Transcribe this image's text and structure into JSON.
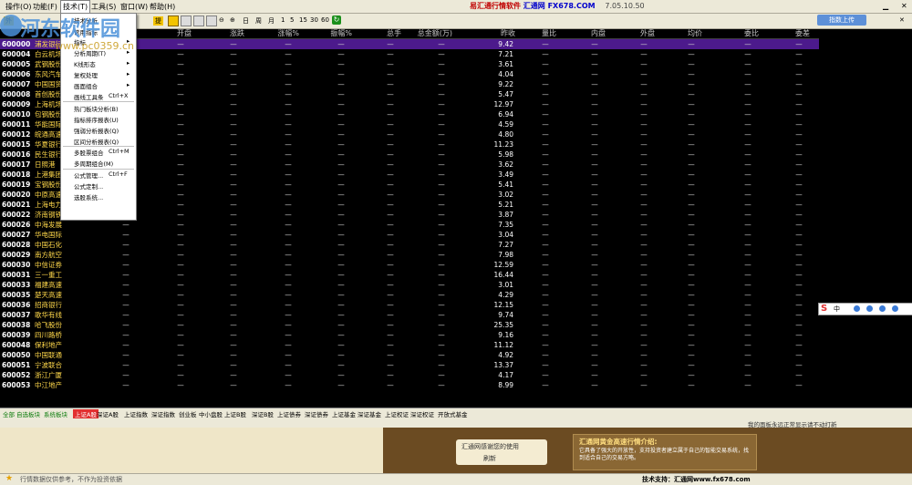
{
  "menu": {
    "items": [
      "操作(O)",
      "功能(F)",
      "技术(T)",
      "工具(S)",
      "窗口(W)",
      "帮助(H)"
    ],
    "active_index": 2,
    "app_title": "易汇通行情软件",
    "app_site": "汇通网 FX678.COM",
    "version": "7.05.10.50"
  },
  "toolbar": {
    "period_labels": [
      "日",
      "周",
      "月",
      "1",
      "5",
      "15",
      "30",
      "60"
    ],
    "cloud_button": "指数上传",
    "left_label": "外",
    "tab_label": "提"
  },
  "watermark": {
    "text": "河东软件园",
    "url": "www.pc0359.cn"
  },
  "dropdown": {
    "items": [
      {
        "label": "技术分析",
        "acc": "",
        "arrow": false
      },
      {
        "label": "常用指标",
        "acc": "",
        "arrow": false
      },
      {
        "label": "指标",
        "acc": "",
        "arrow": true
      },
      {
        "label": "分析周期(T)",
        "acc": "",
        "arrow": true
      },
      {
        "label": "K线形态",
        "acc": "",
        "arrow": true
      },
      {
        "label": "复权处理",
        "acc": "",
        "arrow": true
      },
      {
        "label": "画面组合",
        "acc": "",
        "arrow": true
      },
      {
        "label": "画线工具条",
        "acc": "Ctrl+X",
        "arrow": false
      },
      {
        "label": "热门板块分析(B)",
        "acc": "",
        "arrow": false
      },
      {
        "label": "指标排序报表(U)",
        "acc": "",
        "arrow": false
      },
      {
        "label": "强弱分析报表(Q)",
        "acc": "",
        "arrow": false
      },
      {
        "label": "区间分析报表(Q)",
        "acc": "",
        "arrow": false
      },
      {
        "label": "多股票组合",
        "acc": "Ctrl+M",
        "arrow": false
      },
      {
        "label": "多周期组合(M)",
        "acc": "",
        "arrow": false
      },
      {
        "label": "公式管理...",
        "acc": "Ctrl+F",
        "arrow": false
      },
      {
        "label": "公式定制...",
        "acc": "",
        "arrow": false
      },
      {
        "label": "选股系统...",
        "acc": "",
        "arrow": false
      }
    ]
  },
  "table": {
    "columns": [
      "涨幅",
      "开盘",
      "涨跌",
      "涨幅%",
      "振幅%",
      "总手",
      "总金额(万)",
      "昨收",
      "量比",
      "内盘",
      "外盘",
      "均价",
      "委比",
      "委差"
    ],
    "rows": [
      {
        "code": "600000",
        "name": "浦发银行",
        "prev": "9.42",
        "selected": true
      },
      {
        "code": "600004",
        "name": "白云机场",
        "prev": "7.21",
        "selected": false
      },
      {
        "code": "600005",
        "name": "武钢股份",
        "prev": "3.61",
        "selected": false
      },
      {
        "code": "600006",
        "name": "东风汽车",
        "prev": "4.04",
        "selected": false
      },
      {
        "code": "600007",
        "name": "中国国贸",
        "prev": "9.22",
        "selected": false
      },
      {
        "code": "600008",
        "name": "首创股份",
        "prev": "5.47",
        "selected": false
      },
      {
        "code": "600009",
        "name": "上海机场",
        "prev": "12.97",
        "selected": false
      },
      {
        "code": "600010",
        "name": "包钢股份",
        "prev": "6.94",
        "selected": false
      },
      {
        "code": "600011",
        "name": "华能国际",
        "prev": "4.59",
        "selected": false
      },
      {
        "code": "600012",
        "name": "皖通高速",
        "prev": "4.80",
        "selected": false
      },
      {
        "code": "600015",
        "name": "华夏银行",
        "prev": "11.23",
        "selected": false
      },
      {
        "code": "600016",
        "name": "民生银行",
        "prev": "5.98",
        "selected": false
      },
      {
        "code": "600017",
        "name": "日照港",
        "prev": "3.62",
        "selected": false
      },
      {
        "code": "600018",
        "name": "上港集团",
        "prev": "3.49",
        "selected": false
      },
      {
        "code": "600019",
        "name": "宝钢股份",
        "prev": "5.41",
        "selected": false
      },
      {
        "code": "600020",
        "name": "中原高速",
        "prev": "3.02",
        "selected": false
      },
      {
        "code": "600021",
        "name": "上海电力",
        "prev": "5.21",
        "selected": false
      },
      {
        "code": "600022",
        "name": "济南钢铁",
        "prev": "3.87",
        "selected": false
      },
      {
        "code": "600026",
        "name": "中海发展",
        "prev": "7.35",
        "selected": false
      },
      {
        "code": "600027",
        "name": "华电国际",
        "prev": "3.04",
        "selected": false
      },
      {
        "code": "600028",
        "name": "中国石化",
        "prev": "7.27",
        "selected": false
      },
      {
        "code": "600029",
        "name": "南方航空",
        "prev": "7.98",
        "selected": false
      },
      {
        "code": "600030",
        "name": "中信证券",
        "prev": "12.59",
        "selected": false
      },
      {
        "code": "600031",
        "name": "三一重工",
        "prev": "16.44",
        "selected": false
      },
      {
        "code": "600033",
        "name": "福建高速",
        "prev": "3.01",
        "selected": false
      },
      {
        "code": "600035",
        "name": "楚天高速",
        "prev": "4.29",
        "selected": false
      },
      {
        "code": "600036",
        "name": "招商银行",
        "prev": "12.15",
        "selected": false
      },
      {
        "code": "600037",
        "name": "歌华有线",
        "prev": "9.74",
        "selected": false
      },
      {
        "code": "600038",
        "name": "哈飞股份",
        "prev": "25.35",
        "selected": false
      },
      {
        "code": "600039",
        "name": "四川路桥",
        "prev": "9.16",
        "selected": false
      },
      {
        "code": "600048",
        "name": "保利地产",
        "prev": "11.12",
        "selected": false
      },
      {
        "code": "600050",
        "name": "中国联通",
        "prev": "4.92",
        "selected": false
      },
      {
        "code": "600051",
        "name": "宁波联合",
        "prev": "13.37",
        "selected": false
      },
      {
        "code": "600052",
        "name": "浙江广厦",
        "prev": "4.17",
        "selected": false
      },
      {
        "code": "600053",
        "name": "中江地产",
        "prev": "8.99",
        "selected": false
      }
    ],
    "empty_cell": "—"
  },
  "bottom_tabs": {
    "items": [
      "全部",
      "自选板块",
      "系统板块",
      "上证A股",
      "深证A股",
      "上证指数",
      "深证指数",
      "创业板",
      "中小盘股",
      "上证B股",
      "深证B股",
      "上证债券",
      "深证债券",
      "上证基金",
      "深证基金",
      "上证权证",
      "深证权证",
      "开放式基金"
    ],
    "active_index": 3
  },
  "status_right": "我的面板永远正常显示请不动打新",
  "ad": {
    "center_title": "汇通网感谢您的使用",
    "refresh_label": "刷新",
    "box_title": "汇通网黄金高速行情介绍:",
    "box_body": "它具备了强大的开放性，支持投资者建立属于自己的智能交易系统，找到适合自己的交易方略。"
  },
  "footer": {
    "left": "行情数据仅供参考，不作为投资依据",
    "right": "技术支持：汇通网www.fx678.com"
  }
}
